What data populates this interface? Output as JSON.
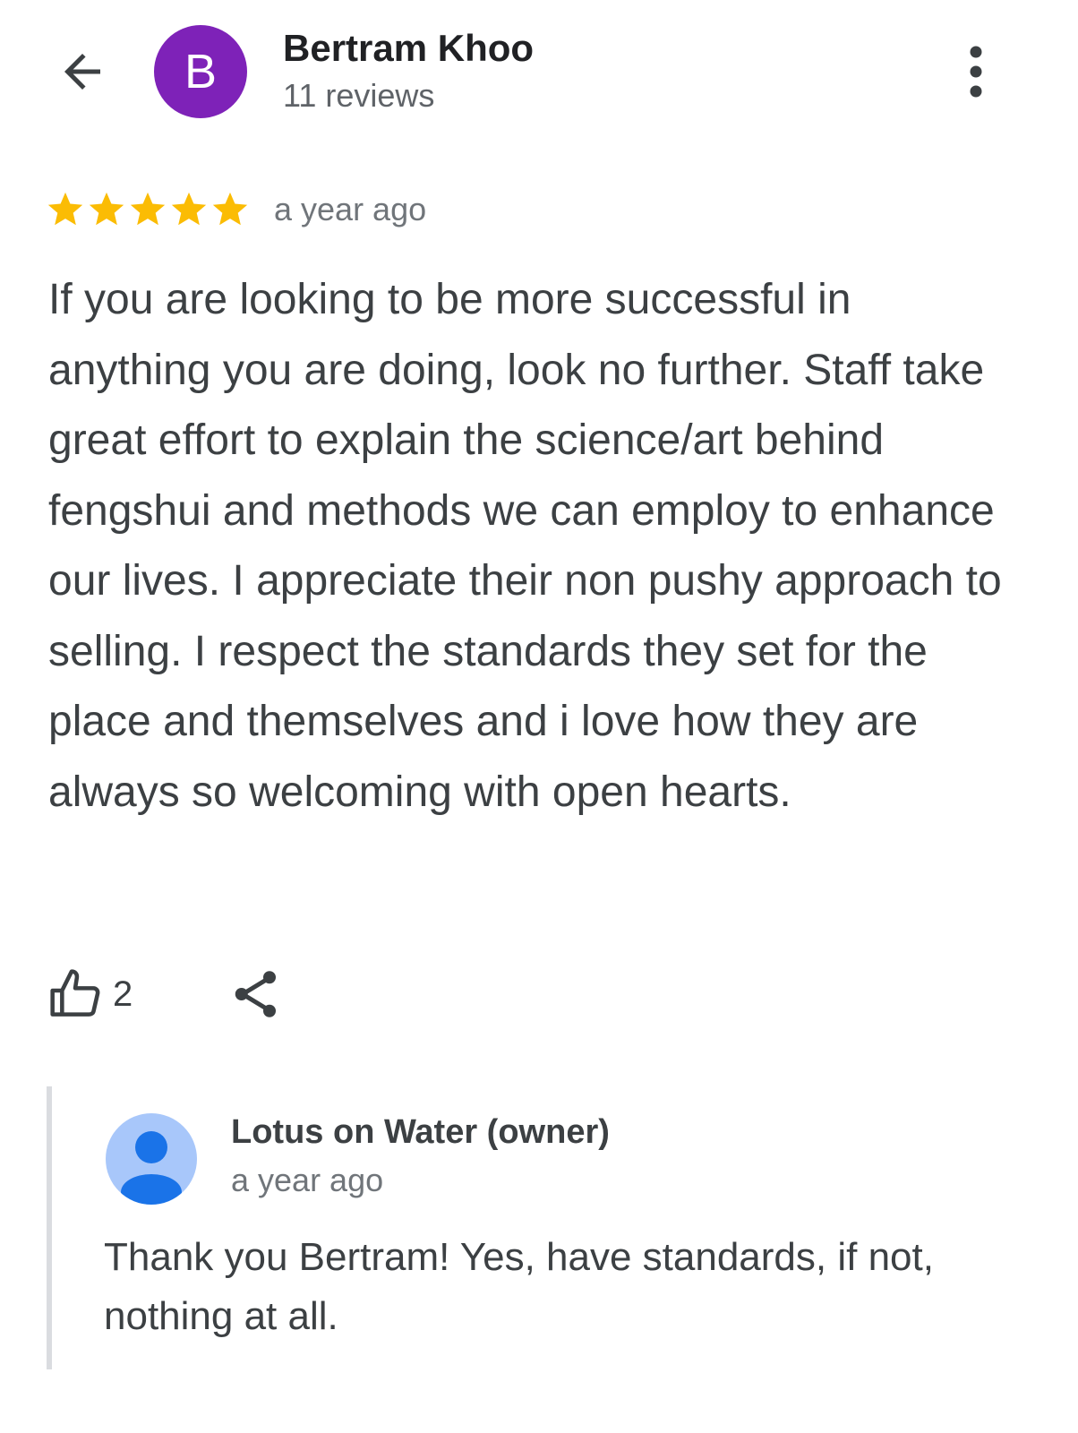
{
  "header": {
    "avatar_initial": "B",
    "reviewer_name": "Bertram Khoo",
    "review_count": "11 reviews",
    "back_icon": "arrow-left-icon",
    "more_icon": "more-vert-icon"
  },
  "review": {
    "rating": 5,
    "rating_max": 5,
    "date": "a year ago",
    "text": "If you are looking to be more successful in anything you are doing, look no further. Staff take great effort to explain the science/art behind fengshui and methods we can employ to enhance our lives. I appreciate their non pushy approach to selling. I respect the standards they set for the place and themselves and i love how they are always so welcoming with open hearts.",
    "like_count": "2",
    "like_icon": "thumbs-up-icon",
    "share_icon": "share-icon"
  },
  "owner_reply": {
    "name": "Lotus on Water (owner)",
    "date": "a year ago",
    "text": "Thank you Bertram! Yes, have standards, if not, nothing at all.",
    "avatar_icon": "person-avatar-icon"
  },
  "colors": {
    "avatar_bg": "#7e22b8",
    "star": "#fbbc04",
    "owner_avatar_bg": "#a8c7fa",
    "owner_avatar_fg": "#1a73e8",
    "reply_border": "#dadce0"
  }
}
